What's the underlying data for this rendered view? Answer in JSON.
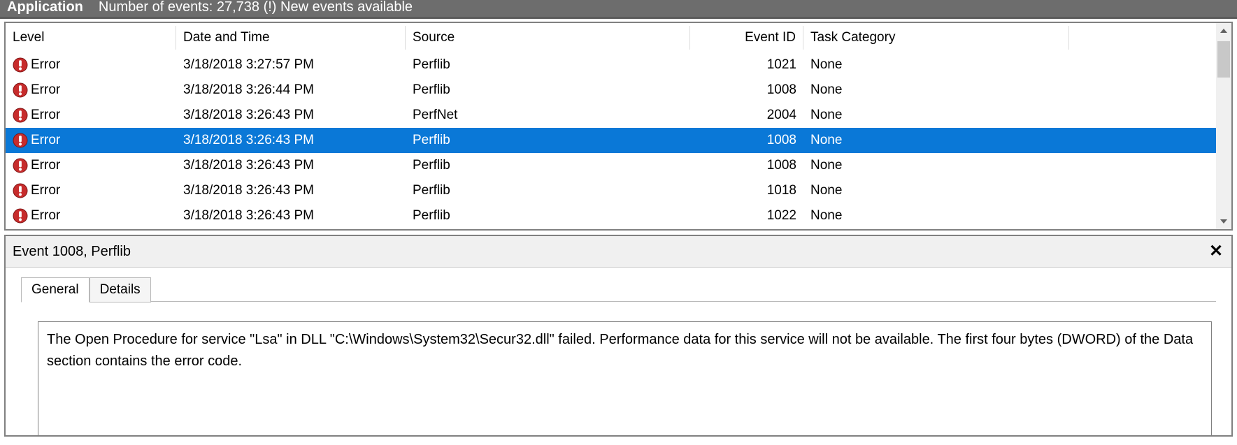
{
  "statusBar": {
    "appName": "Application",
    "text": "Number of events: 27,738 (!) New events available"
  },
  "columns": {
    "level": "Level",
    "datetime": "Date and Time",
    "source": "Source",
    "eventId": "Event ID",
    "taskCategory": "Task Category"
  },
  "events": [
    {
      "level": "Error",
      "datetime": "3/18/2018 3:27:57 PM",
      "source": "Perflib",
      "eventId": "1021",
      "taskCategory": "None",
      "selected": false
    },
    {
      "level": "Error",
      "datetime": "3/18/2018 3:26:44 PM",
      "source": "Perflib",
      "eventId": "1008",
      "taskCategory": "None",
      "selected": false
    },
    {
      "level": "Error",
      "datetime": "3/18/2018 3:26:43 PM",
      "source": "PerfNet",
      "eventId": "2004",
      "taskCategory": "None",
      "selected": false
    },
    {
      "level": "Error",
      "datetime": "3/18/2018 3:26:43 PM",
      "source": "Perflib",
      "eventId": "1008",
      "taskCategory": "None",
      "selected": true
    },
    {
      "level": "Error",
      "datetime": "3/18/2018 3:26:43 PM",
      "source": "Perflib",
      "eventId": "1008",
      "taskCategory": "None",
      "selected": false
    },
    {
      "level": "Error",
      "datetime": "3/18/2018 3:26:43 PM",
      "source": "Perflib",
      "eventId": "1018",
      "taskCategory": "None",
      "selected": false
    },
    {
      "level": "Error",
      "datetime": "3/18/2018 3:26:43 PM",
      "source": "Perflib",
      "eventId": "1022",
      "taskCategory": "None",
      "selected": false
    }
  ],
  "details": {
    "title": "Event 1008, Perflib",
    "tabs": {
      "general": "General",
      "details": "Details"
    },
    "message": "The Open Procedure for service \"Lsa\" in DLL \"C:\\Windows\\System32\\Secur32.dll\" failed. Performance data for this service will not be available. The first four bytes (DWORD) of the Data section contains the error code."
  }
}
